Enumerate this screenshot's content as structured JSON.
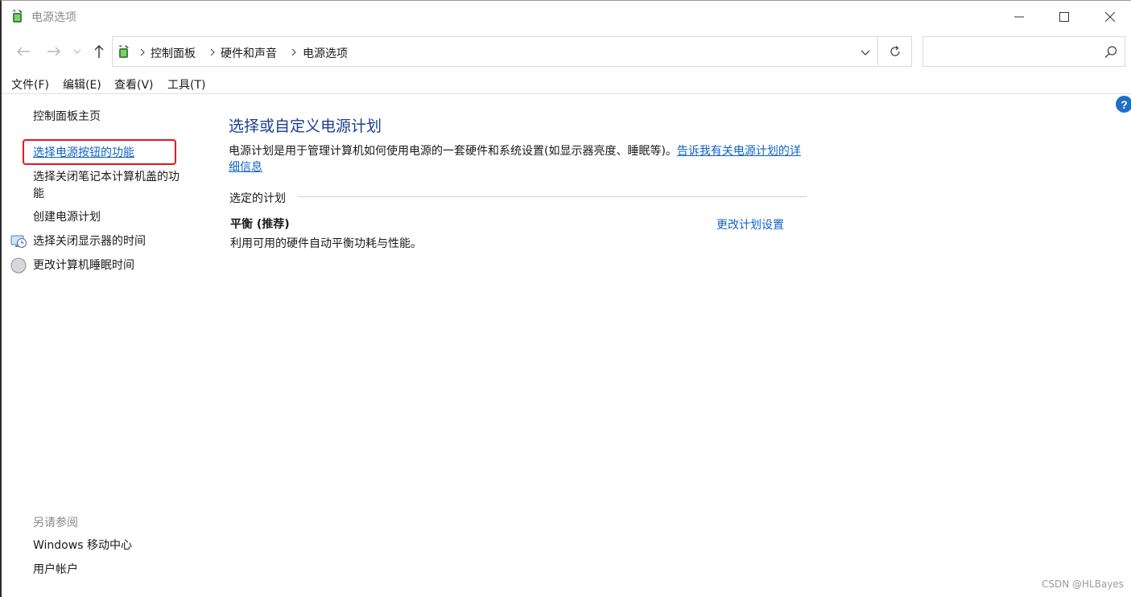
{
  "window": {
    "title": "电源选项",
    "icon": "power-options-icon"
  },
  "nav": {
    "back_icon": "back-arrow-icon",
    "forward_icon": "forward-arrow-icon",
    "recent_icon": "chevron-down-icon",
    "up_icon": "up-arrow-icon",
    "breadcrumbs": [
      "控制面板",
      "硬件和声音",
      "电源选项"
    ],
    "search_placeholder": ""
  },
  "menu": {
    "items": [
      "文件(F)",
      "编辑(E)",
      "查看(V)",
      "工具(T)"
    ]
  },
  "left": {
    "home": "控制面板主页",
    "links": [
      "选择电源按钮的功能",
      "选择关闭笔记本计算机盖的功",
      "能",
      "创建电源计划",
      "选择关闭显示器的时间",
      "更改计算机睡眠时间"
    ],
    "see_also_label": "另请参阅",
    "see_also": [
      "Windows 移动中心",
      "用户帐户"
    ]
  },
  "main": {
    "title": "选择或自定义电源计划",
    "desc_text": "电源计划是用于管理计算机如何使用电源的一套硬件和系统设置(如显示器亮度、睡眠等)。",
    "desc_link": "告诉我有关电源计划的详细信息",
    "section_label": "选定的计划",
    "plan": {
      "name": "平衡 (推荐)",
      "desc": "利用可用的硬件自动平衡功耗与性能。",
      "link": "更改计划设置"
    }
  },
  "help_symbol": "?",
  "watermark": "CSDN @HLBayes",
  "colors": {
    "link": "#0f62c8",
    "title": "#1e3e8f",
    "highlight_box": "#e8141e",
    "help": "#1e6fc5"
  }
}
